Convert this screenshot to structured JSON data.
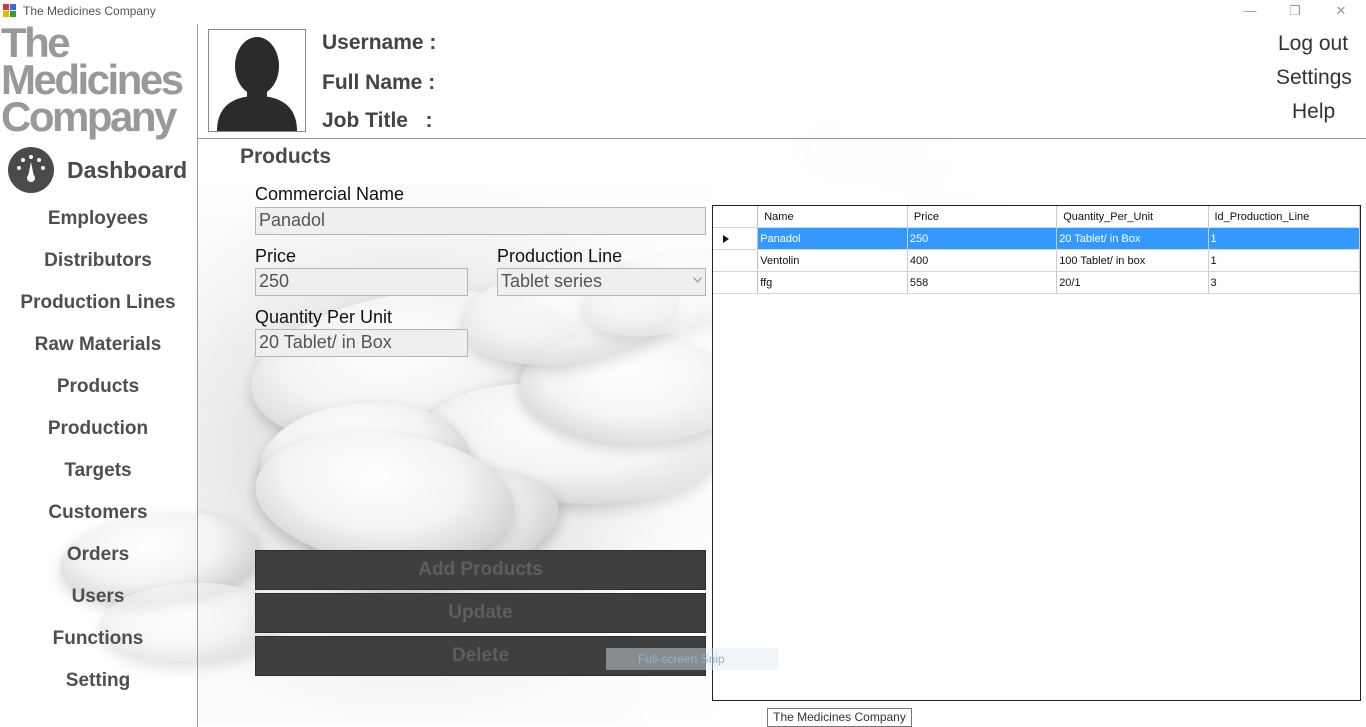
{
  "window": {
    "title": "The Medicines Company",
    "minimize": "—",
    "restore": "❐",
    "close": "✕"
  },
  "logo": {
    "line1": "The",
    "line2": "Medicines",
    "line3": "Company"
  },
  "header": {
    "username_label": "Username :",
    "fullname_label": "Full Name :",
    "jobtitle_label": "Job Title   :",
    "logout": "Log out",
    "settings": "Settings",
    "help": "Help"
  },
  "sidebar": {
    "dashboard": "Dashboard",
    "items": [
      "Employees",
      "Distributors",
      "Production Lines",
      "Raw Materials",
      "Products",
      "Production",
      "Targets",
      "Customers",
      "Orders",
      "Users",
      "Functions",
      "Setting"
    ]
  },
  "form": {
    "section_title": "Products",
    "commercial_name_label": "Commercial Name",
    "commercial_name_value": "Panadol",
    "price_label": "Price",
    "price_value": "250",
    "production_line_label": "Production Line",
    "production_line_value": "Tablet series",
    "qty_label": "Quantity Per Unit",
    "qty_value": "20 Tablet/ in Box"
  },
  "buttons": {
    "add": "Add Products",
    "update": "Update",
    "delete": "Delete"
  },
  "tooltip_fullscreen": "Full-screen Snip",
  "grid": {
    "columns": [
      "Name",
      "Price",
      "Quantity_Per_Unit",
      "Id_Production_Line"
    ],
    "rows": [
      [
        "Panadol",
        "250",
        "20 Tablet/ in Box",
        "1"
      ],
      [
        "Ventolin",
        "400",
        "100 Tablet/ in box",
        "1"
      ],
      [
        "ffg",
        "558",
        "20/1",
        "3"
      ]
    ],
    "selected_row": 0,
    "row_indicator": "▶"
  },
  "status_tooltip": "The Medicines Company",
  "colors": {
    "selection": "#3399ff",
    "button_bg": "#3f3f3f",
    "logo_gray": "#999999"
  }
}
